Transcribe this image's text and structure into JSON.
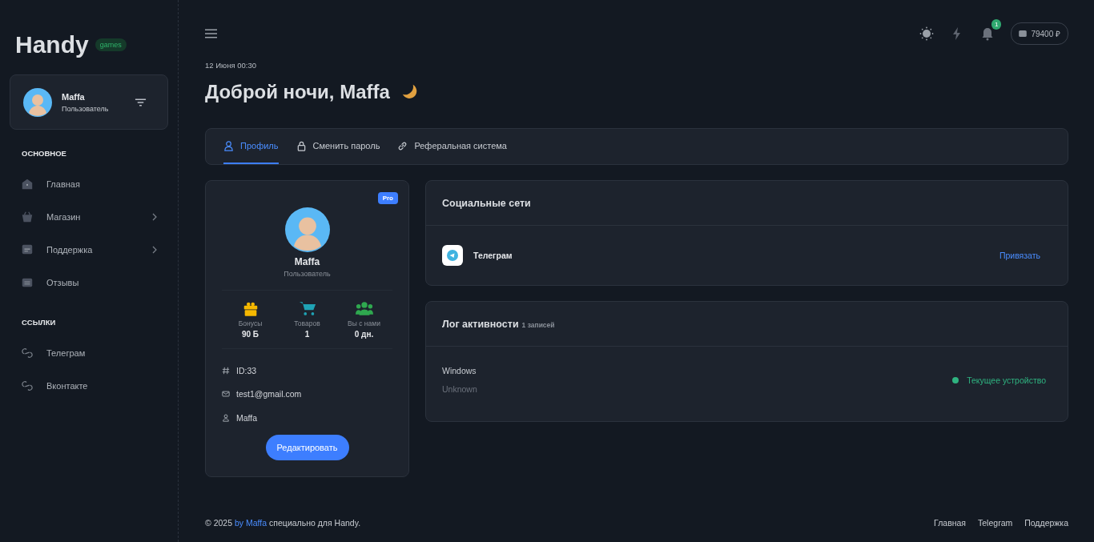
{
  "sidebar": {
    "logo": "Handy",
    "logo_badge": "games",
    "user": {
      "name": "Maffa",
      "role": "Пользователь"
    },
    "sections": [
      {
        "title": "ОСНОВНОЕ",
        "items": [
          {
            "label": "Главная",
            "kind": "home",
            "has_submenu": false
          },
          {
            "label": "Магазин",
            "kind": "basket",
            "has_submenu": true
          },
          {
            "label": "Поддержка",
            "kind": "support",
            "has_submenu": true
          },
          {
            "label": "Отзывы",
            "kind": "reviews",
            "has_submenu": false
          }
        ]
      },
      {
        "title": "ССЫЛКИ",
        "items": [
          {
            "label": "Телеграм",
            "kind": "link",
            "has_submenu": false
          },
          {
            "label": "Вконтакте",
            "kind": "link",
            "has_submenu": false
          }
        ]
      }
    ]
  },
  "topbar": {
    "notifications": "1",
    "balance": "79400 ₽"
  },
  "date": "12 Июня 00:30",
  "greeting": "Доброй ночи, Maffa",
  "tabs": [
    {
      "label": "Профиль",
      "kind": "user",
      "selected": true
    },
    {
      "label": "Сменить пароль",
      "kind": "lock",
      "selected": false
    },
    {
      "label": "Реферальная система",
      "kind": "link",
      "selected": false
    }
  ],
  "profile": {
    "badge": "Pro",
    "name": "Maffa",
    "role": "Пользователь",
    "stats": [
      {
        "kind": "gift",
        "label": "Бонусы",
        "value": "90 Б",
        "color": "#f5b800"
      },
      {
        "kind": "cart",
        "label": "Товаров",
        "value": "1",
        "color": "#1fa3b5"
      },
      {
        "kind": "users",
        "label": "Вы с нами",
        "value": "0 дн.",
        "color": "#2fa84f"
      }
    ],
    "details": [
      {
        "kind": "hash",
        "text": "ID:33"
      },
      {
        "kind": "mail",
        "text": "test1@gmail.com"
      },
      {
        "kind": "user",
        "text": "Maffa"
      }
    ],
    "edit_button": "Редактировать"
  },
  "social": {
    "title": "Социальные сети",
    "items": [
      {
        "name": "Телеграм",
        "action": "Привязать"
      }
    ]
  },
  "activity": {
    "title": "Лог активности",
    "count": "1 записей",
    "entries": [
      {
        "os": "Windows",
        "browser": "Unknown",
        "status": "Текущее устройство",
        "color": "#2fb380"
      }
    ]
  },
  "footer": {
    "prefix": "© 2025",
    "link": "by Maffa",
    "suffix": "специально для Handy.",
    "links": [
      "Главная",
      "Telegram",
      "Поддержка"
    ]
  }
}
